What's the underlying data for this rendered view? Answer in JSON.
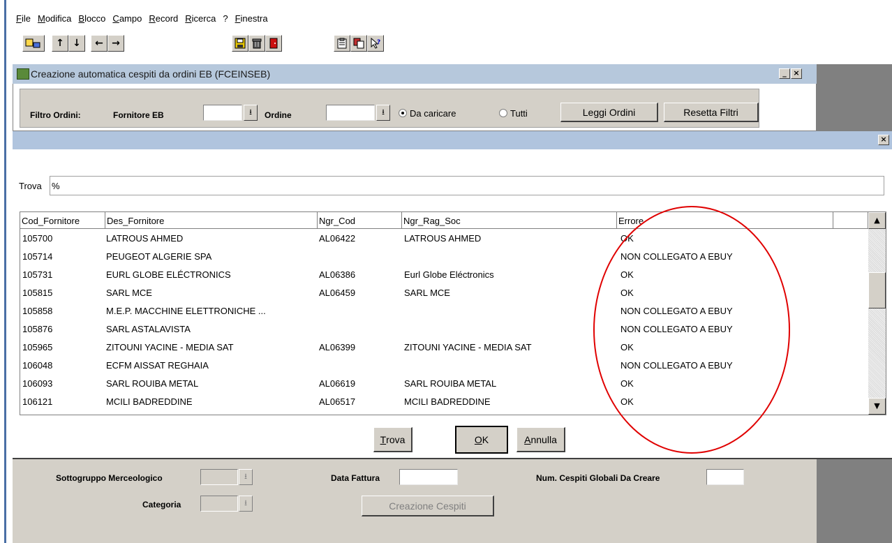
{
  "menu": [
    {
      "label": "File",
      "ul": "F",
      "rest": "ile"
    },
    {
      "label": "Modifica",
      "ul": "M",
      "rest": "odifica"
    },
    {
      "label": "Blocco",
      "ul": "B",
      "rest": "locco"
    },
    {
      "label": "Campo",
      "ul": "C",
      "rest": "ampo"
    },
    {
      "label": "Record",
      "ul": "R",
      "rest": "ecord"
    },
    {
      "label": "Ricerca",
      "ul": "R",
      "rest": "icerca"
    },
    {
      "label": "?",
      "ul": "",
      "rest": "?"
    },
    {
      "label": "Finestra",
      "ul": "F",
      "rest": "inestra"
    }
  ],
  "toolbar": {
    "up_arrow": "↑",
    "down_arrow": "↓",
    "left_arrow": "←",
    "right_arrow": "→"
  },
  "main_window": {
    "title": "Creazione automatica cespiti da ordini EB (FCEINSEB)",
    "minimize": "_",
    "close": "×"
  },
  "filter": {
    "label": "Filtro Ordini:",
    "fornitore_label": "Fornitore EB",
    "ordine_label": "Ordine",
    "radio_da_caricare": "Da caricare",
    "radio_tutti": "Tutti",
    "leggi_ordini": "Leggi Ordini",
    "resetta_filtri": "Resetta Filtri",
    "dropdown_glyph": "⭳"
  },
  "dialog": {
    "close": "×",
    "trova_label": "Trova",
    "trova_value": "%",
    "columns": [
      "Cod_Fornitore",
      "Des_Fornitore",
      "Ngr_Cod",
      "Ngr_Rag_Soc",
      "Errore"
    ],
    "rows": [
      [
        "105700",
        "LATROUS AHMED",
        "AL06422",
        "LATROUS AHMED",
        "OK"
      ],
      [
        "105714",
        "PEUGEOT ALGERIE SPA",
        "",
        "",
        "NON COLLEGATO A EBUY"
      ],
      [
        "105731",
        "EURL GLOBE ELÉCTRONICS",
        "AL06386",
        "Eurl Globe Eléctronics",
        "OK"
      ],
      [
        "105815",
        "SARL MCE",
        "AL06459",
        "SARL MCE",
        "OK"
      ],
      [
        "105858",
        "M.E.P. MACCHINE ELETTRONICHE ...",
        "",
        "",
        "NON COLLEGATO A EBUY"
      ],
      [
        "105876",
        "SARL ASTALAVISTA",
        "",
        "",
        "NON COLLEGATO A EBUY"
      ],
      [
        "105965",
        "ZITOUNI YACINE - MEDIA SAT",
        "AL06399",
        "ZITOUNI YACINE - MEDIA SAT",
        "OK"
      ],
      [
        "106048",
        "ECFM AISSAT REGHAIA",
        "",
        "",
        "NON COLLEGATO A EBUY"
      ],
      [
        "106093",
        "SARL ROUIBA METAL",
        "AL06619",
        "SARL ROUIBA METAL",
        "OK"
      ],
      [
        "106121",
        "MCILI BADREDDINE",
        "AL06517",
        "MCILI BADREDDINE",
        "OK"
      ]
    ],
    "scroll_up": "▲",
    "scroll_down": "▼",
    "btn_trova_ul": "T",
    "btn_trova_rest": "rova",
    "btn_ok_ul": "O",
    "btn_ok_rest": "K",
    "btn_annulla_ul": "A",
    "btn_annulla_rest": "nnulla"
  },
  "bottom": {
    "sottogruppo_label": "Sottogruppo Merceologico",
    "categoria_label": "Categoria",
    "data_fattura_label": "Data Fattura",
    "num_cespiti_label": "Num. Cespiti Globali Da Creare",
    "creazione_cespiti": "Creazione Cespiti"
  },
  "colors": {
    "highlight_ellipse": "#e00000",
    "title_bar": "#b6c8dc",
    "panel": "#d4d0c8"
  }
}
